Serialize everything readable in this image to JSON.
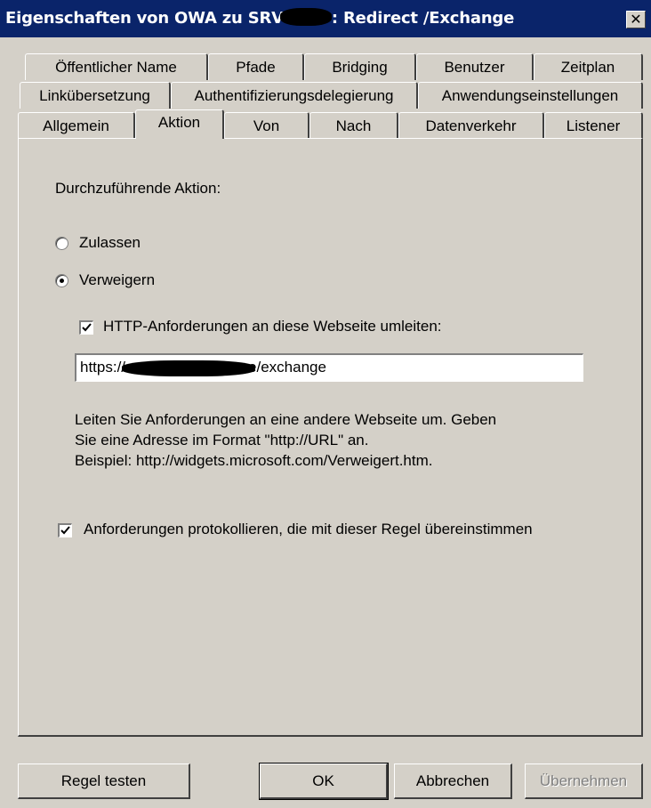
{
  "window": {
    "title_part1": "Eigenschaften von OWA zu SRV",
    "title_part2": ": Redirect /Exchange",
    "close_label": "✕"
  },
  "tabs": {
    "row1": [
      "Öffentlicher Name",
      "Pfade",
      "Bridging",
      "Benutzer",
      "Zeitplan"
    ],
    "row2": [
      "Linkübersetzung",
      "Authentifizierungsdelegierung",
      "Anwendungseinstellungen"
    ],
    "row3": [
      "Allgemein",
      "Aktion",
      "Von",
      "Nach",
      "Datenverkehr",
      "Listener"
    ],
    "active": "Aktion"
  },
  "action": {
    "heading": "Durchzuführende Aktion:",
    "allow_label": "Zulassen",
    "allow_selected": false,
    "deny_label": "Verweigern",
    "deny_selected": true,
    "redirect_label": "HTTP-Anforderungen an diese Webseite umleiten:",
    "redirect_checked": true,
    "url_prefix": "https://",
    "url_suffix": "e/exchange",
    "hint_line1": "Leiten Sie Anforderungen an eine andere Webseite um. Geben",
    "hint_line2": "Sie eine Adresse im Format \"http://URL\" an.",
    "hint_line3": "Beispiel: http://widgets.microsoft.com/Verweigert.htm.",
    "log_label": "Anforderungen protokollieren, die mit dieser Regel übereinstimmen",
    "log_checked": true
  },
  "buttons": {
    "test": "Regel testen",
    "ok": "OK",
    "cancel": "Abbrechen",
    "apply": "Übernehmen",
    "apply_disabled": true
  },
  "colors": {
    "titlebar": "#0a246a",
    "face": "#d4d0c8"
  }
}
